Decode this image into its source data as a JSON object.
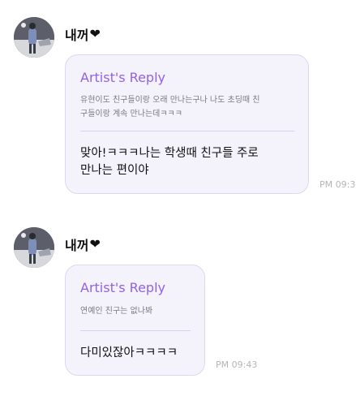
{
  "messages": [
    {
      "sender": "내꺼",
      "heart_icon": "heart-icon",
      "reply_title": "Artist's Reply",
      "quote_lines": [
        "유현이도 친구들이랑 오래 만나는구나 나도 초딩때 친",
        "구들이랑 계속 만나는데ㅋㅋㅋ"
      ],
      "reply_lines": [
        "맞아!ㅋㅋㅋ나는 학생때 친구들 주로",
        "만나는 편이야"
      ],
      "time": "PM 09:3"
    },
    {
      "sender": "내꺼",
      "heart_icon": "heart-icon",
      "reply_title": "Artist's Reply",
      "quote_lines": [
        "연예인 친구는 없나봐"
      ],
      "reply_lines": [
        "다미있잖아ㅋㅋㅋㅋ"
      ],
      "time": "PM 09:43"
    }
  ]
}
